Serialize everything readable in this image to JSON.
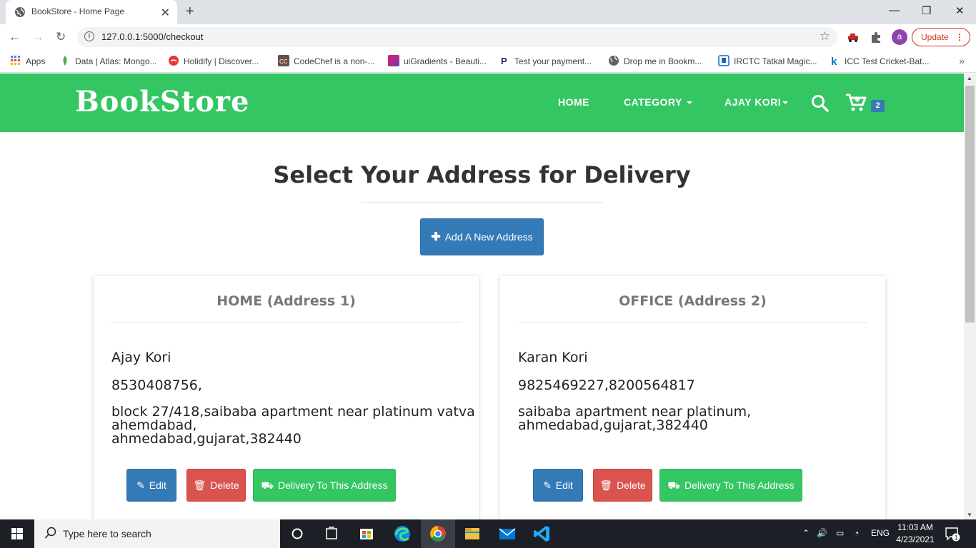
{
  "browser": {
    "tab_title": "BookStore - Home Page",
    "url": "127.0.0.1:5000/checkout",
    "update_label": "Update",
    "profile_initial": "a",
    "bookmarks": [
      {
        "label": "Apps",
        "color": "#4285f4"
      },
      {
        "label": "Data | Atlas: Mongo...",
        "color": "#4caf50"
      },
      {
        "label": "Holidify | Discover...",
        "color": "#e53935"
      },
      {
        "label": "CodeChef is a non-...",
        "color": "#6d4c41"
      },
      {
        "label": "uiGradients - Beauti...",
        "color": "#8e24aa"
      },
      {
        "label": "Test your payment...",
        "color": "#1a237e"
      },
      {
        "label": "Drop me in Bookm...",
        "color": "#5f6368"
      },
      {
        "label": "IRCTC Tatkal Magic...",
        "color": "#1565c0"
      },
      {
        "label": "ICC Test Cricket-Bat...",
        "color": "#0277bd"
      }
    ]
  },
  "navbar": {
    "brand": "BookStore",
    "links": {
      "home": "HOME",
      "category": "CATEGORY",
      "user": "AJAY KORI"
    },
    "cart_count": "2",
    "color": "#34c662"
  },
  "main": {
    "title": "Select Your Address for Delivery",
    "add_button": "Add A New Address"
  },
  "addresses": [
    {
      "heading": "HOME (Address 1)",
      "name": "Ajay Kori",
      "phone": "8530408756,",
      "line1": "block 27/418,saibaba apartment near platinum vatva",
      "line2": "ahemdabad,",
      "line3": "ahmedabad,gujarat,382440",
      "edit": "Edit",
      "delete": "Delete",
      "deliver": "Delivery To This Address"
    },
    {
      "heading": "OFFICE (Address 2)",
      "name": "Karan Kori",
      "phone": "9825469227,8200564817",
      "line1": "saibaba apartment near platinum,",
      "line2": "ahmedabad,gujarat,382440",
      "line3": "",
      "edit": "Edit",
      "delete": "Delete",
      "deliver": "Delivery To This Address"
    }
  ],
  "taskbar": {
    "search_placeholder": "Type here to search",
    "language": "ENG",
    "time": "11:03 AM",
    "date": "4/23/2021",
    "notification_count": "1"
  }
}
